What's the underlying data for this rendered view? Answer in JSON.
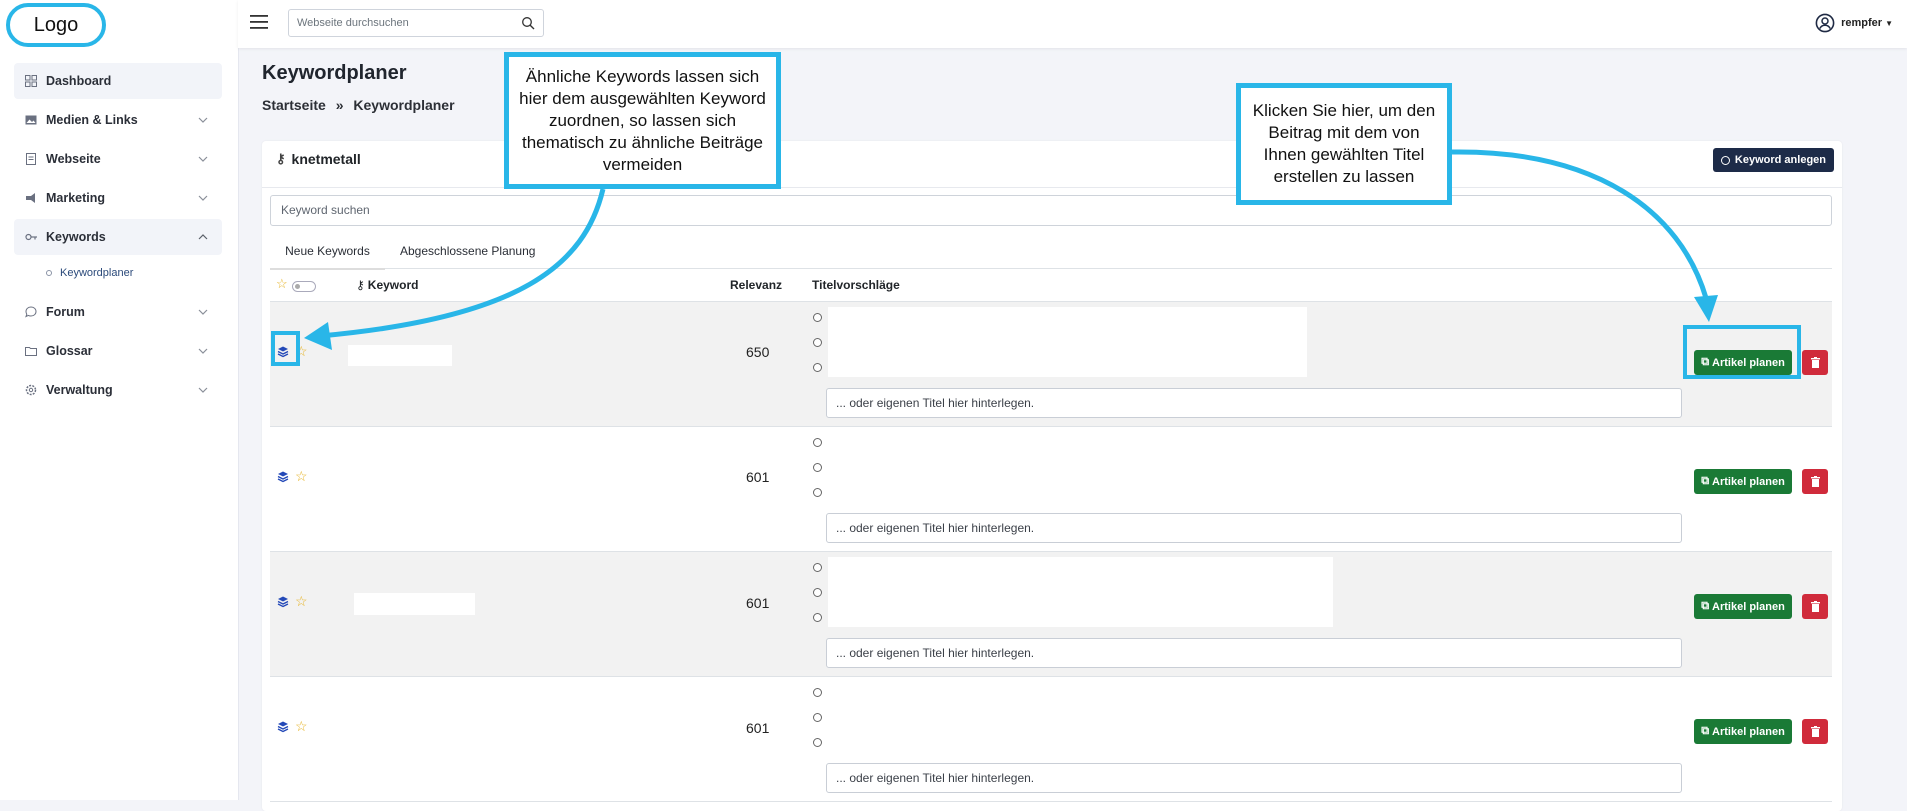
{
  "logo": "Logo",
  "topbar": {
    "search_placeholder": "Webseite durchsuchen",
    "user": "rempfer"
  },
  "sidebar": {
    "items": [
      {
        "label": "Dashboard",
        "icon": "grid-icon"
      },
      {
        "label": "Medien & Links",
        "icon": "image-icon"
      },
      {
        "label": "Webseite",
        "icon": "page-icon"
      },
      {
        "label": "Marketing",
        "icon": "megaphone-icon"
      },
      {
        "label": "Keywords",
        "icon": "key-icon"
      },
      {
        "label": "Forum",
        "icon": "chat-icon"
      },
      {
        "label": "Glossar",
        "icon": "folder-icon"
      },
      {
        "label": "Verwaltung",
        "icon": "gear-icon"
      }
    ],
    "subitem": "Keywordplaner"
  },
  "page": {
    "title": "Keywordplaner",
    "crumb_home": "Startseite",
    "crumb_sep": "»",
    "crumb_current": "Keywordplaner"
  },
  "card": {
    "title": "knetmetall",
    "create_button": "Keyword anlegen",
    "search_placeholder": "Keyword suchen",
    "tabs": [
      "Neue Keywords",
      "Abgeschlossene Planung"
    ],
    "headers": {
      "keyword": "Keyword",
      "relevance": "Relevanz",
      "titles": "Titelvorschläge"
    }
  },
  "rows": [
    {
      "relevance": "650",
      "own_title_placeholder": "... oder eigenen Titel hier hinterlegen.",
      "plan_button": "Artikel planen"
    },
    {
      "relevance": "601",
      "own_title_placeholder": "... oder eigenen Titel hier hinterlegen.",
      "plan_button": "Artikel planen"
    },
    {
      "relevance": "601",
      "own_title_placeholder": "... oder eigenen Titel hier hinterlegen.",
      "plan_button": "Artikel planen"
    },
    {
      "relevance": "601",
      "own_title_placeholder": "... oder eigenen Titel hier hinterlegen.",
      "plan_button": "Artikel planen"
    }
  ],
  "annotations": {
    "left": "Ähnliche Keywords lassen sich hier dem ausgewählten Keyword zuordnen, so lassen sich thematisch zu ähnliche Beiträge vermeiden",
    "right": "Klicken Sie hier, um den Beitrag mit dem von Ihnen gewählten Titel erstellen zu lassen"
  },
  "colors": {
    "accent_annotation": "#29b6e8",
    "plan_button": "#1a7a36",
    "delete_button": "#d02b3b",
    "create_button": "#1d2b48",
    "star": "#e6b325"
  }
}
